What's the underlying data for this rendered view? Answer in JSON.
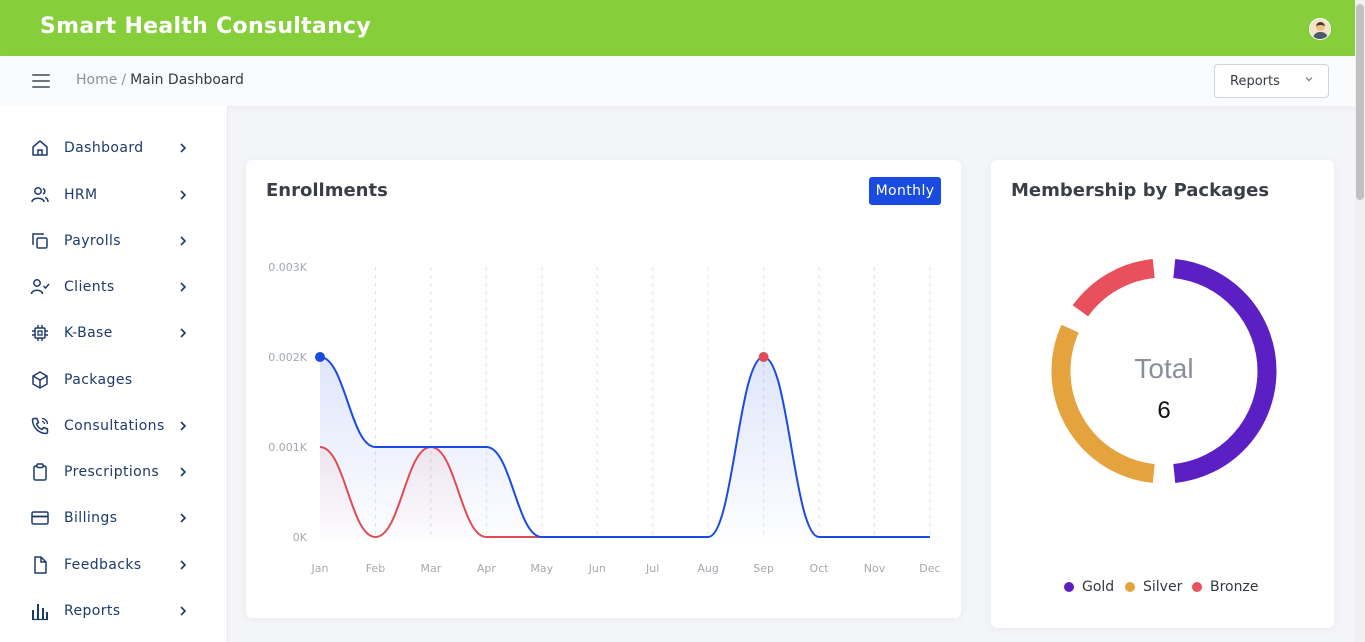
{
  "app": {
    "title": "Smart Health Consultancy"
  },
  "breadcrumb": {
    "home": "Home",
    "separator": "/",
    "current": "Main Dashboard"
  },
  "reports_select": {
    "value": "Reports"
  },
  "sidebar": {
    "items": [
      {
        "label": "Dashboard",
        "icon": "home-icon",
        "has_arrow": true
      },
      {
        "label": "HRM",
        "icon": "users-icon",
        "has_arrow": true
      },
      {
        "label": "Payrolls",
        "icon": "copy-icon",
        "has_arrow": true
      },
      {
        "label": "Clients",
        "icon": "user-check-icon",
        "has_arrow": true
      },
      {
        "label": "K-Base",
        "icon": "cpu-icon",
        "has_arrow": true
      },
      {
        "label": "Packages",
        "icon": "package-icon",
        "has_arrow": false
      },
      {
        "label": "Consultations",
        "icon": "phone-call-icon",
        "has_arrow": true
      },
      {
        "label": "Prescriptions",
        "icon": "clipboard-icon",
        "has_arrow": true
      },
      {
        "label": "Billings",
        "icon": "credit-card-icon",
        "has_arrow": true
      },
      {
        "label": "Feedbacks",
        "icon": "file-icon",
        "has_arrow": true
      },
      {
        "label": "Reports",
        "icon": "bar-chart-icon",
        "has_arrow": true
      }
    ]
  },
  "enrollments": {
    "title": "Enrollments",
    "period_button": "Monthly"
  },
  "membership": {
    "title": "Membership by Packages",
    "center_label": "Total",
    "center_value": "6"
  },
  "colors": {
    "topbar": "#86cf3a",
    "accent_blue": "#1a4be0",
    "series_red": "#e04b55",
    "gold": "#5b1fc4",
    "silver": "#e4a33c",
    "bronze": "#e8505b"
  },
  "chart_data": [
    {
      "type": "area",
      "title": "Enrollments",
      "categories": [
        "Jan",
        "Feb",
        "Mar",
        "Apr",
        "May",
        "Jun",
        "Jul",
        "Aug",
        "Sep",
        "Oct",
        "Nov",
        "Dec"
      ],
      "y_tick_labels": [
        "0K",
        "0.001K",
        "0.002K",
        "0.003K"
      ],
      "ylim": [
        0,
        3
      ],
      "grid": "vertical dashed",
      "series": [
        {
          "color": "#1a4be0",
          "values": [
            2,
            1,
            1,
            1,
            0,
            0,
            0,
            0,
            2,
            0,
            0,
            0
          ]
        },
        {
          "color": "#e04b55",
          "values": [
            1,
            0,
            1,
            0,
            0
          ]
        }
      ]
    },
    {
      "type": "pie",
      "title": "Membership by Packages",
      "labels": [
        "Gold",
        "Silver",
        "Bronze"
      ],
      "values": [
        3,
        2,
        1
      ],
      "colors": [
        "#5b1fc4",
        "#e4a33c",
        "#e8505b"
      ],
      "legend": "bottom",
      "center_text": "Total 6"
    }
  ]
}
